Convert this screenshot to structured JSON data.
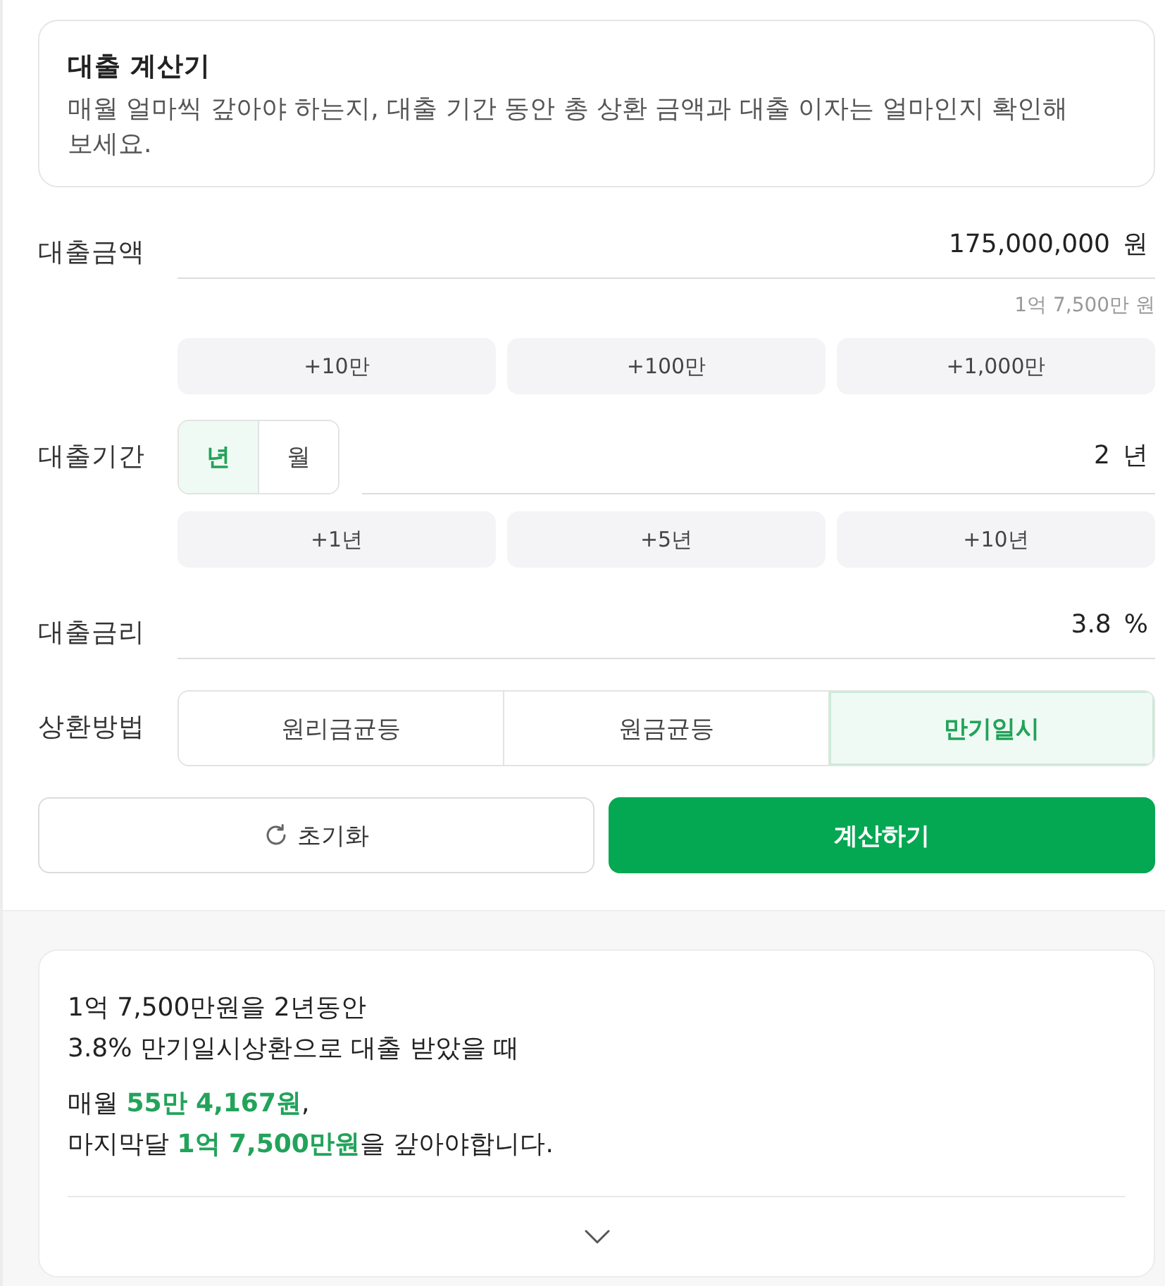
{
  "intro": {
    "title": "대출 계산기",
    "description": "매월 얼마씩 갚아야 하는지, 대출 기간 동안 총 상환 금액과 대출 이자는 얼마인지 확인해 보세요."
  },
  "fields": [
    {
      "kind": "input",
      "label": "대출금액",
      "value": "175,000,000",
      "unit": "원",
      "hint": "1억 7,500만 원",
      "quick_buttons": [
        "+10만",
        "+100만",
        "+1,000만"
      ]
    },
    {
      "kind": "input",
      "label": "대출기간",
      "units": [
        {
          "label": "년",
          "selected": true
        },
        {
          "label": "월",
          "selected": false
        }
      ],
      "value": "2",
      "unit": "년",
      "quick_buttons": [
        "+1년",
        "+5년",
        "+10년"
      ]
    },
    {
      "kind": "input",
      "label": "대출금리",
      "value": "3.8",
      "unit": "%"
    },
    {
      "kind": "choice",
      "label": "상환방법",
      "options": [
        {
          "label": "원리금균등",
          "selected": false
        },
        {
          "label": "원금균등",
          "selected": false
        },
        {
          "label": "만기일시",
          "selected": true
        }
      ]
    }
  ],
  "actions": {
    "reset": "초기화",
    "calculate": "계산하기"
  },
  "result": {
    "summary": [
      "1억 7,500만원을 2년동안",
      "3.8% 만기일시상환으로 대출 받았을 때"
    ],
    "payments": [
      "매월 **55만 4,167원**,",
      "마지막달 **1억 7,500만원**을 갚아야합니다."
    ]
  }
}
